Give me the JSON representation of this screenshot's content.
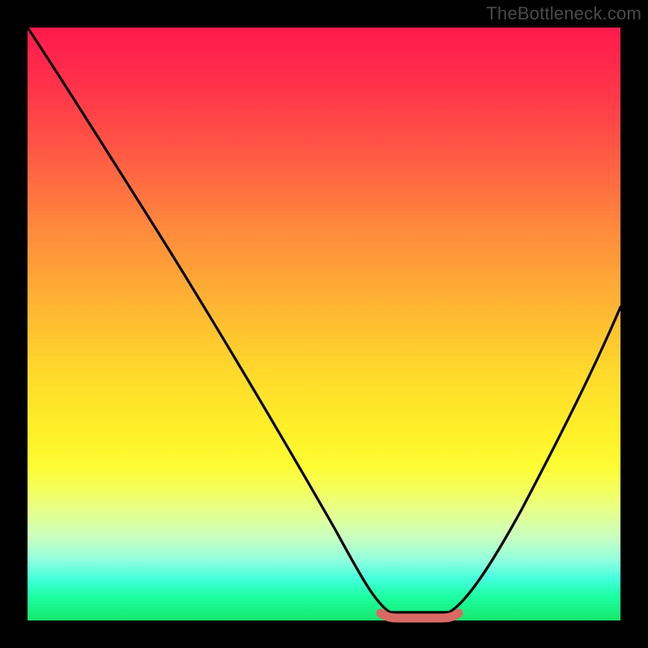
{
  "watermark": "TheBottleneck.com",
  "chart_data": {
    "type": "line",
    "title": "",
    "xlabel": "",
    "ylabel": "",
    "xlim": [
      0,
      100
    ],
    "ylim": [
      0,
      100
    ],
    "series": [
      {
        "name": "curve",
        "x": [
          0,
          5,
          10,
          15,
          20,
          25,
          30,
          35,
          40,
          45,
          50,
          55,
          58,
          62,
          68,
          72,
          75,
          80,
          85,
          90,
          95,
          100
        ],
        "y": [
          100,
          92,
          84,
          76,
          68,
          59,
          50,
          41,
          32,
          23,
          15,
          8,
          3,
          0,
          0,
          0,
          3,
          9,
          18,
          29,
          42,
          58
        ]
      },
      {
        "name": "flat-marker",
        "x": [
          58,
          72
        ],
        "y": [
          0,
          0
        ]
      }
    ],
    "gradient_stops": [
      {
        "pos": 0,
        "color": "#ff1a4d"
      },
      {
        "pos": 20,
        "color": "#ff5545"
      },
      {
        "pos": 46,
        "color": "#ffb233"
      },
      {
        "pos": 68,
        "color": "#fff028"
      },
      {
        "pos": 86,
        "color": "#c8ffc0"
      },
      {
        "pos": 100,
        "color": "#16e86c"
      }
    ],
    "flat_marker_color": "#d96a63",
    "curve_color": "#000000"
  }
}
